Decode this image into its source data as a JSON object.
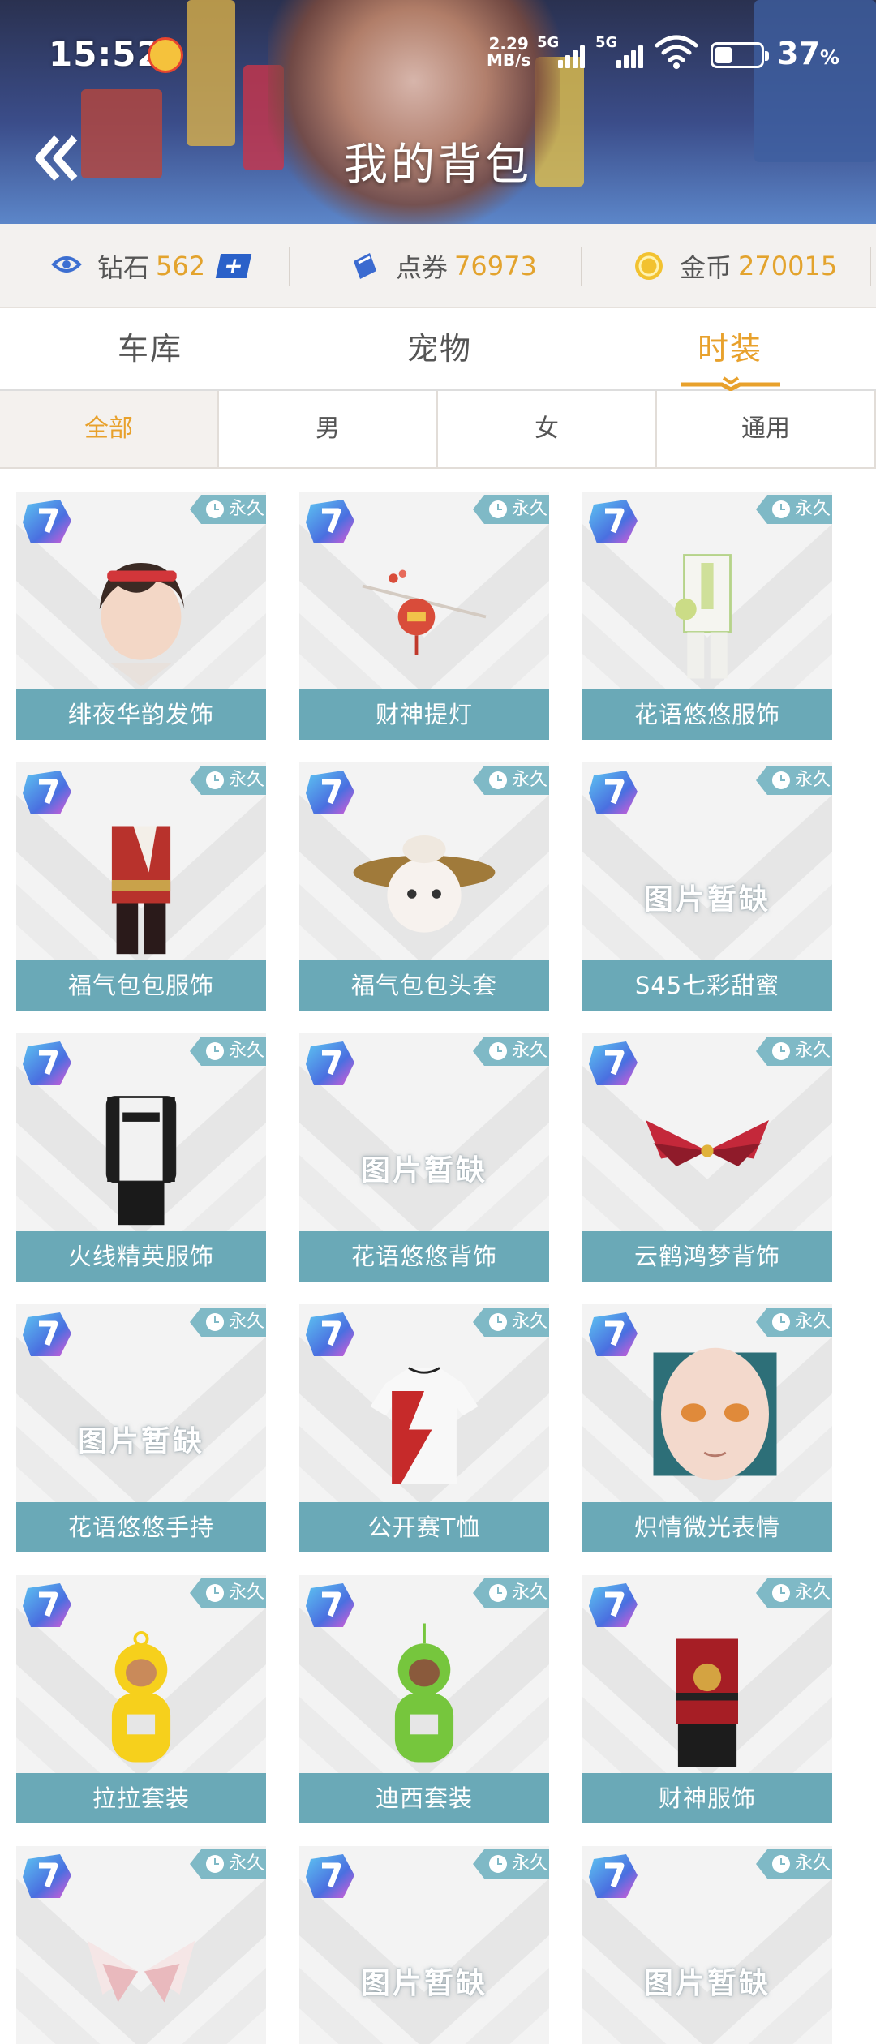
{
  "status_bar": {
    "time": "15:52",
    "net_speed_top": "2.29",
    "net_speed_unit": "MB/s",
    "sim1_label": "5G",
    "sim2_label": "5G",
    "battery_percent": "37",
    "battery_unit": "%"
  },
  "header": {
    "title": "我的背包"
  },
  "currency": [
    {
      "label": "钻石",
      "value": "562"
    },
    {
      "label": "点券",
      "value": "76973"
    },
    {
      "label": "金币",
      "value": "270015"
    }
  ],
  "tabs": [
    {
      "label": "车库"
    },
    {
      "label": "宠物"
    },
    {
      "label": "时装",
      "active": true
    }
  ],
  "filters": [
    {
      "label": "全部",
      "active": true
    },
    {
      "label": "男"
    },
    {
      "label": "女"
    },
    {
      "label": "通用"
    }
  ],
  "perm_label": "永久",
  "missing_image_text": "图片暂缺",
  "items": [
    {
      "name": "绯夜华韵发饰",
      "image": "hair-accessory"
    },
    {
      "name": "财神提灯",
      "image": "lantern"
    },
    {
      "name": "花语悠悠服饰",
      "image": "outfit-white-green"
    },
    {
      "name": "福气包包服饰",
      "image": "outfit-red"
    },
    {
      "name": "福气包包头套",
      "image": "bun-hat"
    },
    {
      "name": "S45七彩甜蜜",
      "image": "missing"
    },
    {
      "name": "火线精英服饰",
      "image": "racing-jacket"
    },
    {
      "name": "花语悠悠背饰",
      "image": "missing"
    },
    {
      "name": "云鹤鸿梦背饰",
      "image": "red-wings"
    },
    {
      "name": "花语悠悠手持",
      "image": "missing"
    },
    {
      "name": "公开赛T恤",
      "image": "tshirt"
    },
    {
      "name": "炽情微光表情",
      "image": "face"
    },
    {
      "name": "拉拉套装",
      "image": "teletubby-yellow"
    },
    {
      "name": "迪西套装",
      "image": "teletubby-green"
    },
    {
      "name": "财神服饰",
      "image": "outfit-dark-red"
    },
    {
      "name": "",
      "image": "white-wings"
    },
    {
      "name": "",
      "image": "missing"
    },
    {
      "name": "",
      "image": "missing"
    }
  ],
  "colors": {
    "accent": "#e8a12c",
    "card_label_bg": "#6aa9b7",
    "perm_tag_bg": "#7fb9c6"
  }
}
